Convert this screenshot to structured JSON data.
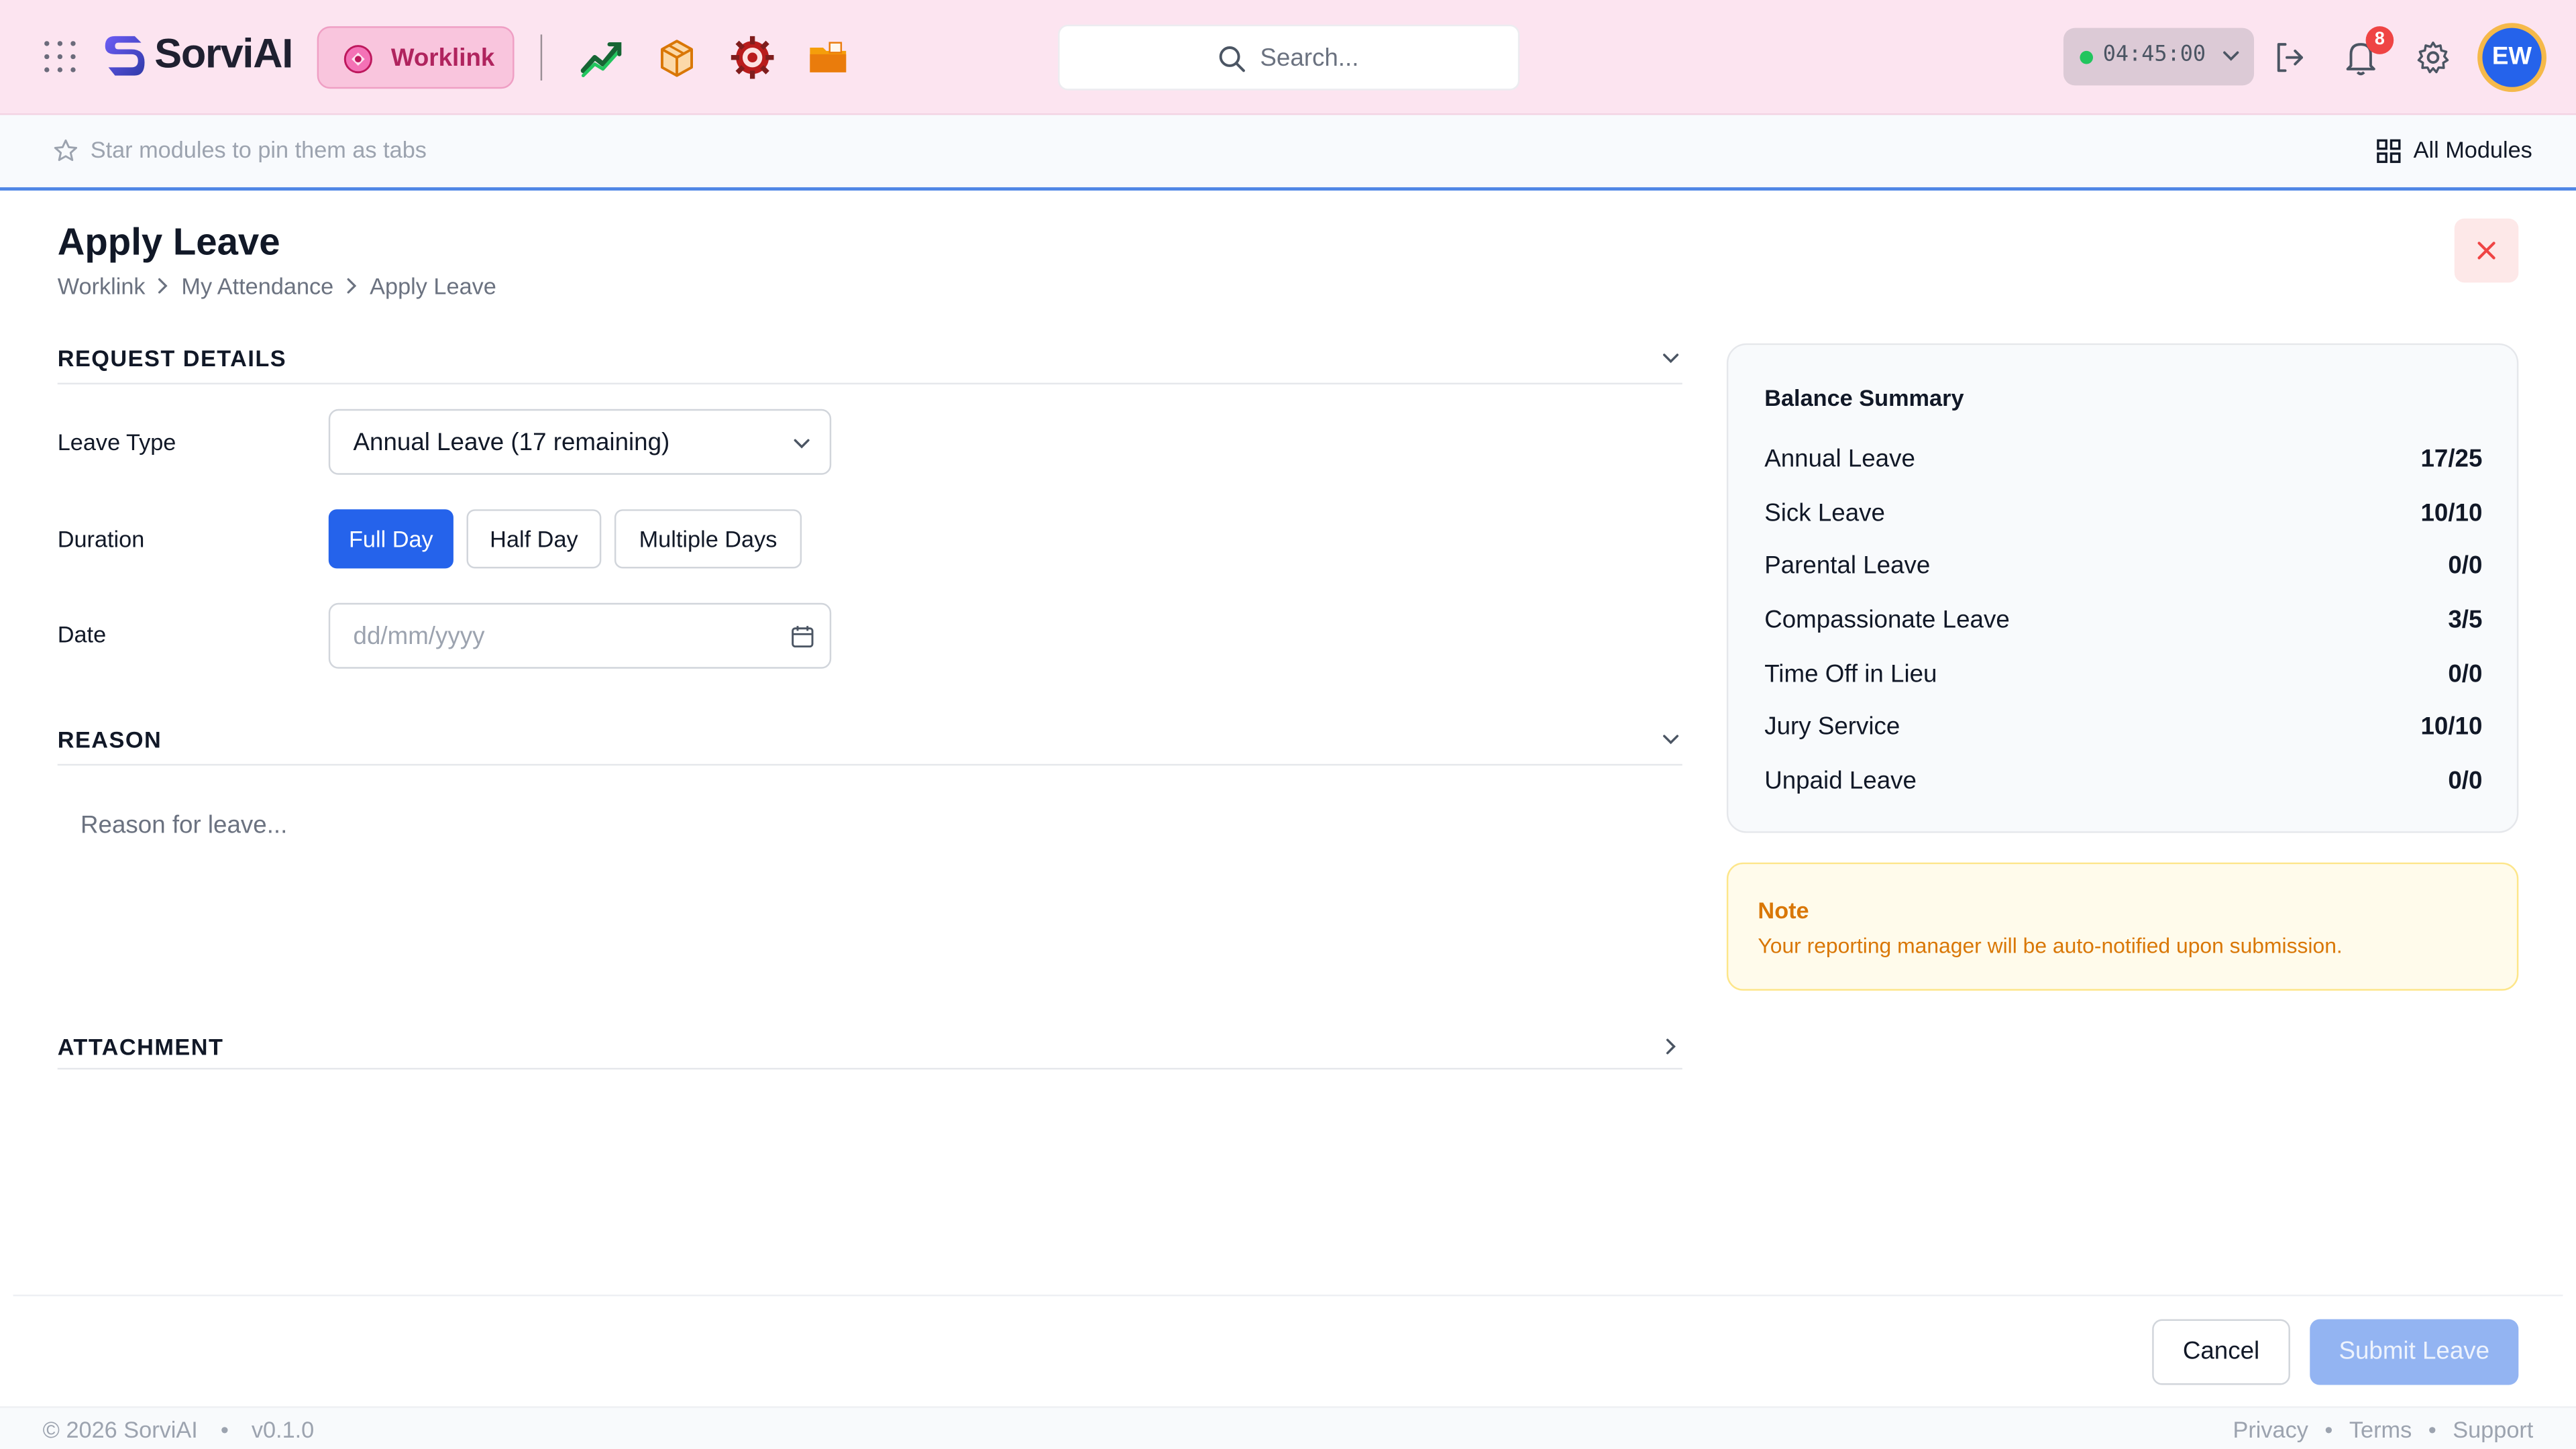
{
  "header": {
    "brand": "SorviAI",
    "active_module": "Worklink",
    "search_placeholder": "Search...",
    "timer": "04:45:00",
    "notification_count": "8",
    "avatar_initials": "EW",
    "module_icons": [
      "trending-up-icon",
      "box-icon",
      "gear-target-icon",
      "folder-icon"
    ]
  },
  "subbar": {
    "hint": "Star modules to pin them as tabs",
    "all_modules_label": "All Modules"
  },
  "page": {
    "title": "Apply Leave",
    "breadcrumb": [
      "Worklink",
      "My Attendance",
      "Apply Leave"
    ]
  },
  "request_details": {
    "section_title": "REQUEST DETAILS",
    "leave_type_label": "Leave Type",
    "leave_type_value": "Annual Leave (17 remaining)",
    "duration_label": "Duration",
    "duration_options": [
      "Full Day",
      "Half Day",
      "Multiple Days"
    ],
    "duration_selected": "Full Day",
    "date_label": "Date",
    "date_placeholder": "dd/mm/yyyy"
  },
  "reason": {
    "section_title": "REASON",
    "placeholder": "Reason for leave..."
  },
  "attachment": {
    "section_title": "ATTACHMENT"
  },
  "balance_summary": {
    "title": "Balance Summary",
    "rows": [
      {
        "name": "Annual Leave",
        "value": "17/25"
      },
      {
        "name": "Sick Leave",
        "value": "10/10"
      },
      {
        "name": "Parental Leave",
        "value": "0/0"
      },
      {
        "name": "Compassionate Leave",
        "value": "3/5"
      },
      {
        "name": "Time Off in Lieu",
        "value": "0/0"
      },
      {
        "name": "Jury Service",
        "value": "10/10"
      },
      {
        "name": "Unpaid Leave",
        "value": "0/0"
      }
    ]
  },
  "note": {
    "title": "Note",
    "text": "Your reporting manager will be auto-notified upon submission."
  },
  "actions": {
    "cancel_label": "Cancel",
    "submit_label": "Submit Leave"
  },
  "footer": {
    "copyright": "© 2026 SorviAI",
    "version": "v0.1.0",
    "links": [
      "Privacy",
      "Terms",
      "Support"
    ]
  },
  "colors": {
    "accent": "#2563eb",
    "header_bg": "#fce4f0",
    "worklink_pink": "#b0245e",
    "note_amber": "#d97706",
    "notification_red": "#ef4444"
  }
}
